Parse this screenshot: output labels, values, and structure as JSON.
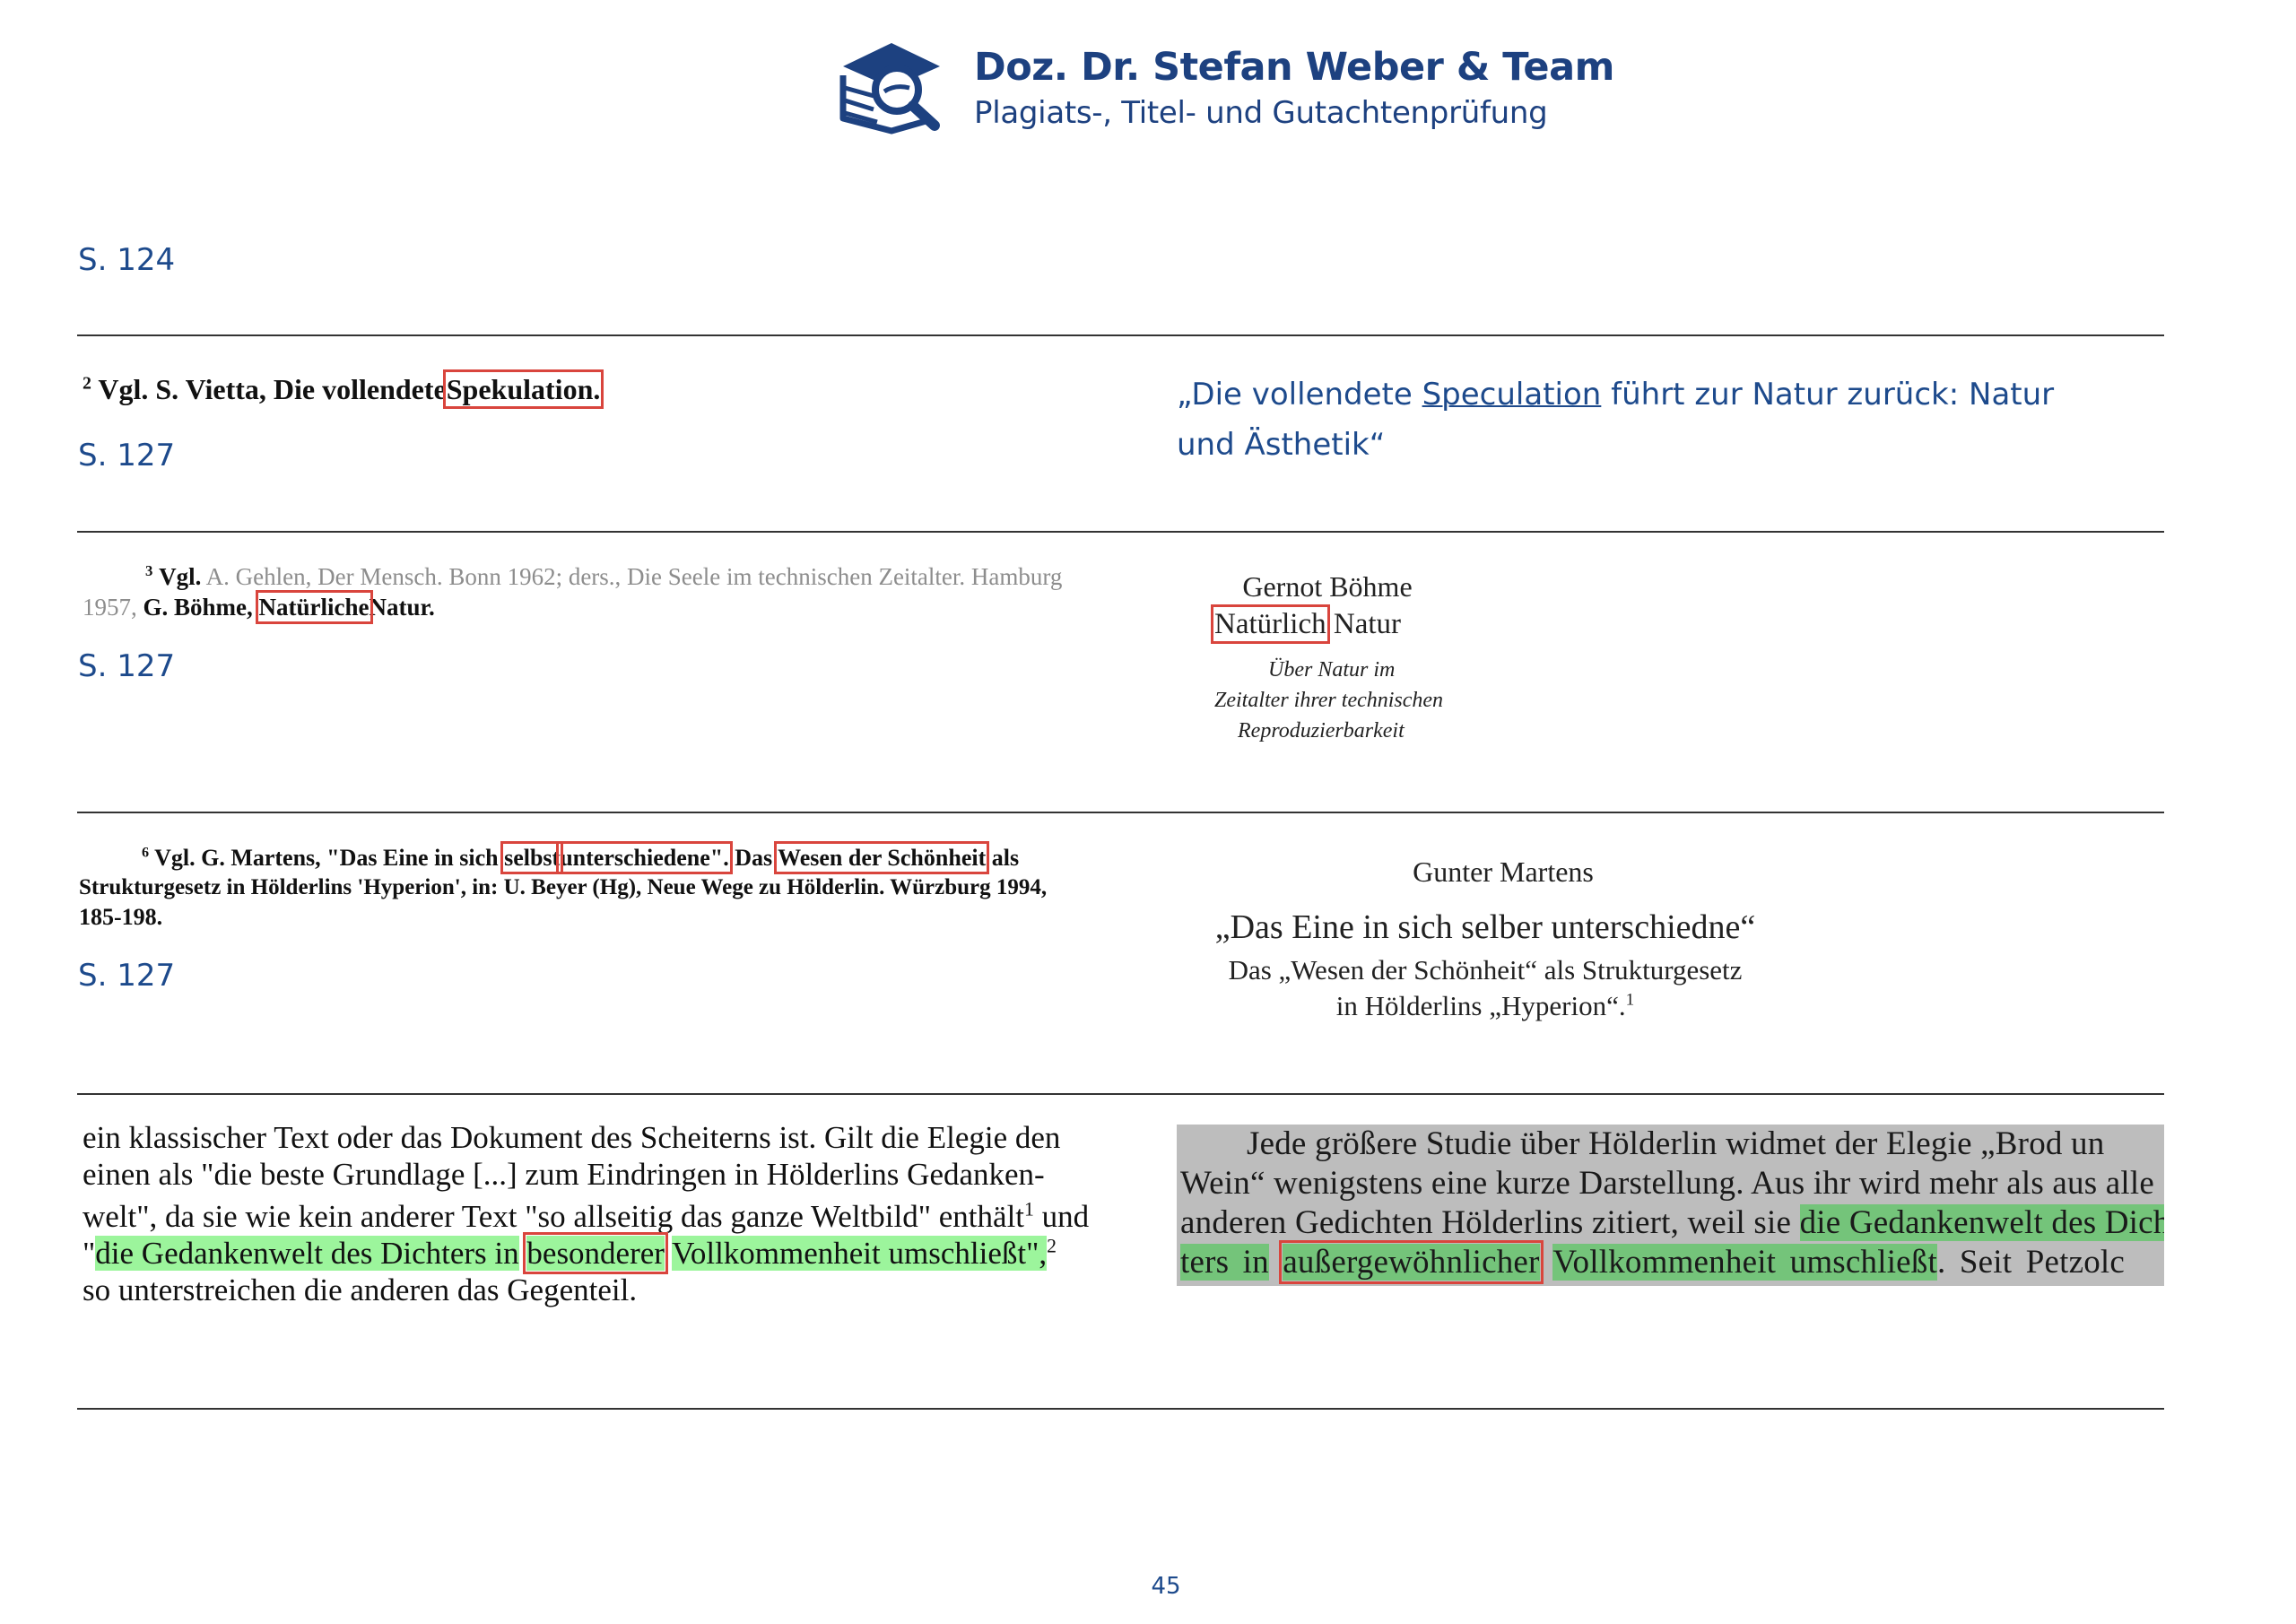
{
  "header": {
    "brand_name": "Doz. Dr. Stefan Weber & Team",
    "brand_tagline": "Plagiats-, Titel- und Gutachtenprüfung",
    "logo_icon": "book-magnifier-logo",
    "brand_color": "#1d4180"
  },
  "section1": {
    "page_label": "S. 124"
  },
  "row1": {
    "left_sup": "2",
    "left_text": "Vgl. S. Vietta, Die vollendete",
    "left_boxed": "Spekulation.",
    "page_label": "S. 127",
    "right_quote_start": "„Die vollendete ",
    "right_quote_underlined": "Speculation",
    "right_quote_end": " führt zur Natur zurück: Natur und Ästhetik“"
  },
  "row2": {
    "left_sup": "3",
    "left_vgl": "Vgl.",
    "left_faded_1": "A. Gehlen, Der Mensch. Bonn 1962; ders., Die Seele im technischen Zeitalter. Hamburg",
    "left_faded_2": "1957,",
    "left_bold_2": "G. Böhme,",
    "left_boxed": "Natürliche",
    "left_end": "Natur.",
    "page_label": "S. 127",
    "book_author": "Gernot Böhme",
    "book_boxed": "Natürlich",
    "book_title_rest": "Natur",
    "book_sub_1": "Über Natur im",
    "book_sub_2": "Zeitalter ihrer technischen",
    "book_sub_3": "Reproduzierbarkeit"
  },
  "row3": {
    "left_sup": "6",
    "left_a": "Vgl. G. Martens, \"Das Eine in sich",
    "left_box1": "selbst",
    "left_box2": "unterschiedene\".",
    "left_b": "Das",
    "left_box3": "Wesen der Schönheit",
    "left_c": "als",
    "left_line2": "Strukturgesetz in Hölderlins 'Hyperion', in: U. Beyer (Hg), Neue Wege zu Hölderlin. Würzburg 1994,",
    "left_line3": "185-198.",
    "page_label": "S. 127",
    "book_author": "Gunter Martens",
    "book_title": "„Das Eine in sich selber unterschiedne“",
    "book_sub_1": "Das „Wesen der Schönheit“ als Strukturgesetz",
    "book_sub_2": "in Hölderlins „Hyperion“.",
    "book_sub_sup": "1"
  },
  "row4": {
    "l1": "ein klassischer Text oder das Dokument des Scheiterns ist. Gilt die Elegie den",
    "l2": "einen als \"die beste Grundlage [...] zum Eindringen in Hölderlins Gedanken-",
    "l3": "welt\", da sie wie kein anderer Text \"so allseitig das ganze Weltbild\" enthält",
    "l3_sup": "1",
    "l3_end": "und",
    "l4_q": "\"",
    "l4_hl_a": "die Gedankenwelt des Dichters in",
    "l4_box": "besonderer",
    "l4_hl_b": "Vollkommenheit umschließt",
    "l4_end": "\",",
    "l4_sup": "2",
    "l5": "so unterstreichen die anderen das Gegenteil.",
    "r1": "Jede größere Studie über Hölderlin widmet der Elegie „Brod un",
    "r2": "Wein“ wenigstens eine kurze Darstellung. Aus ihr wird mehr als aus alle",
    "r3_a": "anderen Gedichten Hölderlins zitiert, weil sie",
    "r3_hl": "die Gedankenwelt des Dich",
    "r4_hl_a": "ters in",
    "r4_box": "außergewöhnlicher",
    "r4_hl_b": "Vollkommenheit umschließt",
    "r4_end": ". Seit Petzolc"
  },
  "footer": {
    "page_number": "45"
  }
}
